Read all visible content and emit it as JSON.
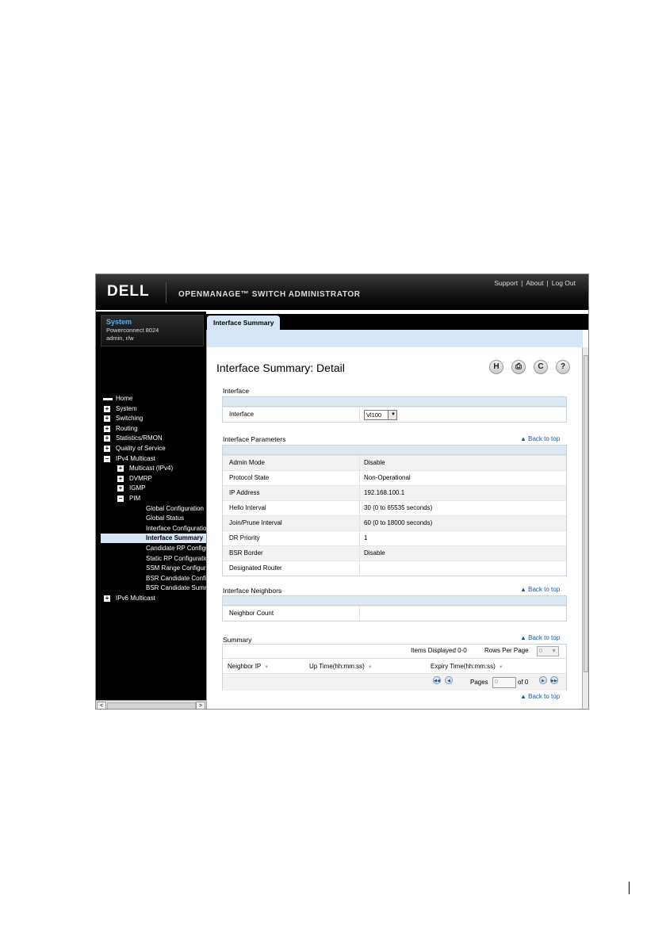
{
  "header": {
    "brand": "DELL",
    "app_title": "OPENMANAGE™ SWITCH ADMINISTRATOR",
    "links": [
      "Support",
      "About",
      "Log Out"
    ]
  },
  "system": {
    "title": "System",
    "model": "Powerconnect 8024",
    "user": "admin, r/w"
  },
  "nav": {
    "items": [
      {
        "label": "Home",
        "level": 0,
        "icon": "home"
      },
      {
        "label": "System",
        "level": 0,
        "icon": "plus"
      },
      {
        "label": "Switching",
        "level": 0,
        "icon": "plus"
      },
      {
        "label": "Routing",
        "level": 0,
        "icon": "plus"
      },
      {
        "label": "Statistics/RMON",
        "level": 0,
        "icon": "plus"
      },
      {
        "label": "Quality of Service",
        "level": 0,
        "icon": "plus"
      },
      {
        "label": "IPv4 Multicast",
        "level": 0,
        "icon": "minus"
      },
      {
        "label": "Multicast (IPv4)",
        "level": 1,
        "icon": "plus"
      },
      {
        "label": "DVMRP",
        "level": 1,
        "icon": "plus"
      },
      {
        "label": "IGMP",
        "level": 1,
        "icon": "plus"
      },
      {
        "label": "PIM",
        "level": 1,
        "icon": "minus"
      },
      {
        "label": "Global Configuration",
        "level": 2,
        "icon": ""
      },
      {
        "label": "Global Status",
        "level": 2,
        "icon": ""
      },
      {
        "label": "Interface Configuration",
        "level": 2,
        "icon": ""
      },
      {
        "label": "Interface Summary",
        "level": 2,
        "icon": "",
        "selected": true
      },
      {
        "label": "Candidate RP Configuration",
        "level": 2,
        "icon": ""
      },
      {
        "label": "Static RP Configuration",
        "level": 2,
        "icon": ""
      },
      {
        "label": "SSM Range Configuration",
        "level": 2,
        "icon": ""
      },
      {
        "label": "BSR Candidate Configuration",
        "level": 2,
        "icon": ""
      },
      {
        "label": "BSR Candidate Summary",
        "level": 2,
        "icon": ""
      },
      {
        "label": "IPv6 Multicast",
        "level": 0,
        "icon": "plus"
      }
    ]
  },
  "tab": {
    "label": "Interface Summary"
  },
  "page": {
    "title": "Interface Summary: Detail"
  },
  "toolbar": {
    "save": "H",
    "print": "⎙",
    "refresh": "C",
    "help": "?"
  },
  "interface_section": {
    "title": "Interface",
    "label": "Interface",
    "value": "Vl100"
  },
  "params_section": {
    "title": "Interface Parameters",
    "back_to_top": "Back to top",
    "rows": [
      {
        "k": "Admin Mode",
        "v": "Disable"
      },
      {
        "k": "Protocol State",
        "v": "Non-Operational"
      },
      {
        "k": "IP Address",
        "v": "192.168.100.1"
      },
      {
        "k": "Hello Interval",
        "v": "30  (0 to 65535 seconds)"
      },
      {
        "k": "Join/Prune Interval",
        "v": "60  (0 to 18000 seconds)"
      },
      {
        "k": "DR Priority",
        "v": "1"
      },
      {
        "k": "BSR Border",
        "v": "Disable"
      },
      {
        "k": "Designated Router",
        "v": ""
      }
    ]
  },
  "neighbors_section": {
    "title": "Interface Neighbors",
    "back_to_top": "Back to top",
    "rows": [
      {
        "k": "Neighbor Count",
        "v": ""
      }
    ]
  },
  "summary_section": {
    "title": "Summary",
    "back_to_top": "Back to top",
    "items_displayed_label": "Items Displayed",
    "items_displayed": "0-0",
    "rows_per_page_label": "Rows Per Page",
    "rows_per_page": "0",
    "columns": [
      "Neighbor IP",
      "Up Time(hh:mm:ss)",
      "Expiry Time(hh:mm:ss)"
    ],
    "pages_label": "Pages",
    "page_value": "0",
    "of_label": "of 0",
    "back_to_top_bottom": "Back to top"
  },
  "colors": {
    "accent": "#d6e6f7",
    "header": "#000000",
    "link": "#1a5aa8"
  }
}
